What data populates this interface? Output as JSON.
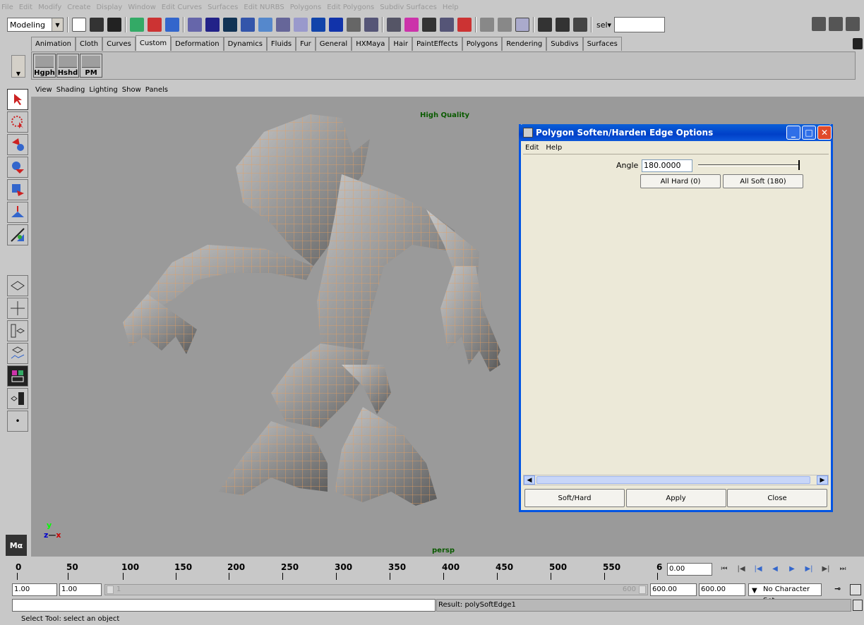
{
  "menubar": {
    "items": [
      "File",
      "Edit",
      "Modify",
      "Create",
      "Display",
      "Window",
      "Edit Curves",
      "Surfaces",
      "Edit NURBS",
      "Polygons",
      "Edit Polygons",
      "Subdiv Surfaces",
      "Help"
    ]
  },
  "statusline": {
    "mode": "Modeling",
    "sel_label": "sel▾",
    "sel_value": ""
  },
  "shelf": {
    "tabs": [
      "Animation",
      "Cloth",
      "Curves",
      "Custom",
      "Deformation",
      "Dynamics",
      "Fluids",
      "Fur",
      "General",
      "HXMaya",
      "Hair",
      "PaintEffects",
      "Polygons",
      "Rendering",
      "Subdivs",
      "Surfaces"
    ],
    "active_tab": "Custom",
    "buttons": [
      "Hgph",
      "Hshd",
      "PM"
    ]
  },
  "panel": {
    "menu": [
      "View",
      "Shading",
      "Lighting",
      "Show",
      "Panels"
    ],
    "hq_label": "High Quality",
    "camera_label": "persp",
    "axis": {
      "y": "y",
      "z": "z",
      "x": "x"
    }
  },
  "dialog": {
    "title": "Polygon Soften/Harden Edge Options",
    "menu": [
      "Edit",
      "Help"
    ],
    "angle_label": "Angle",
    "angle_value": "180.0000",
    "slider_fraction": 1.0,
    "preset_hard": "All Hard (0)",
    "preset_soft": "All Soft (180)",
    "buttons": [
      "Soft/Hard",
      "Apply",
      "Close"
    ]
  },
  "timeline": {
    "ticks": [
      "50",
      "100",
      "150",
      "200",
      "250",
      "300",
      "350",
      "400",
      "450",
      "500",
      "550",
      "6"
    ],
    "start_tick": "0",
    "current_time": "0.00"
  },
  "range": {
    "start": "1.00",
    "playback_start": "1.00",
    "playback_end": "600.00",
    "end": "600.00",
    "range_label": "600",
    "range_start_label": "1",
    "character_set": "No Character Set"
  },
  "command": {
    "result": "Result: polySoftEdge1",
    "help": "Select Tool: select an object"
  },
  "colors": {
    "viewport_bg": "#9a9a9a",
    "wireframe": "#e8a060",
    "dialog_title": "#0040c8"
  }
}
